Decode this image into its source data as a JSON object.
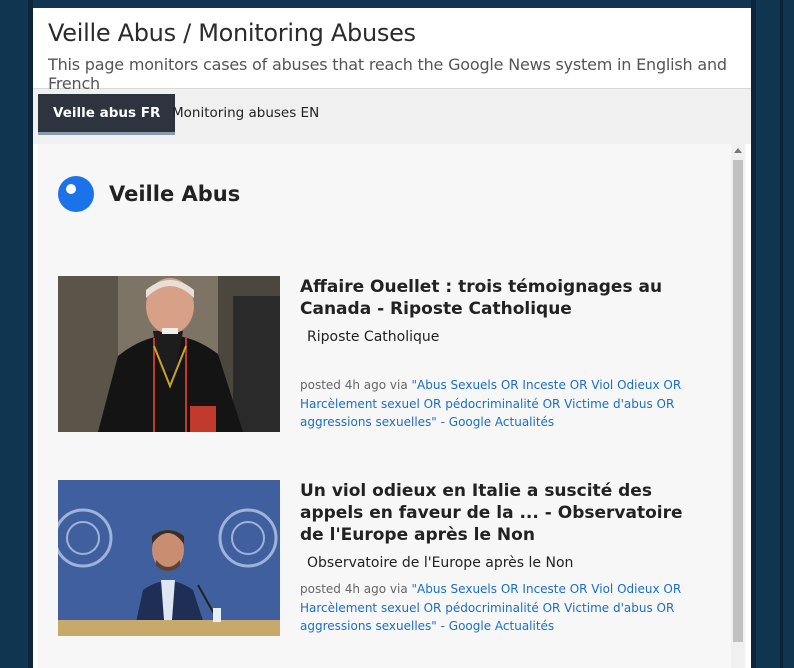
{
  "site": {
    "title": "Veille Abus / Monitoring Abuses",
    "subtitle": "This page monitors cases of abuses that reach the Google News system in English and French"
  },
  "tabs": [
    {
      "label": "Veille abus FR",
      "active": true
    },
    {
      "label": "Monitoring abuses EN",
      "active": false
    }
  ],
  "feed": {
    "title": "Veille Abus",
    "icon": "rss-feed-icon",
    "accent": "#1a73e8"
  },
  "items": [
    {
      "title": "Affaire Ouellet : trois témoignages au Canada - Riposte Catholique",
      "source": "Riposte Catholique",
      "posted": "posted 4h ago via",
      "via": "\"Abus Sexuels OR Inceste OR Viol Odieux OR Harcèlement sexuel OR pédocriminalité OR Victime d'abus OR aggressions sexuelles\" - Google Actualités",
      "thumbnail": "cardinal-photo"
    },
    {
      "title": "Un viol odieux en Italie a suscité des appels en faveur de la ... - Observatoire de l'Europe après le Non",
      "source": "Observatoire de l'Europe après le Non",
      "posted": "posted 4h ago via",
      "via": "\"Abus Sexuels OR Inceste OR Viol Odieux OR Harcèlement sexuel OR pédocriminalité OR Victime d'abus OR aggressions sexuelles\" - Google Actualités",
      "thumbnail": "press-conference-photo"
    }
  ]
}
